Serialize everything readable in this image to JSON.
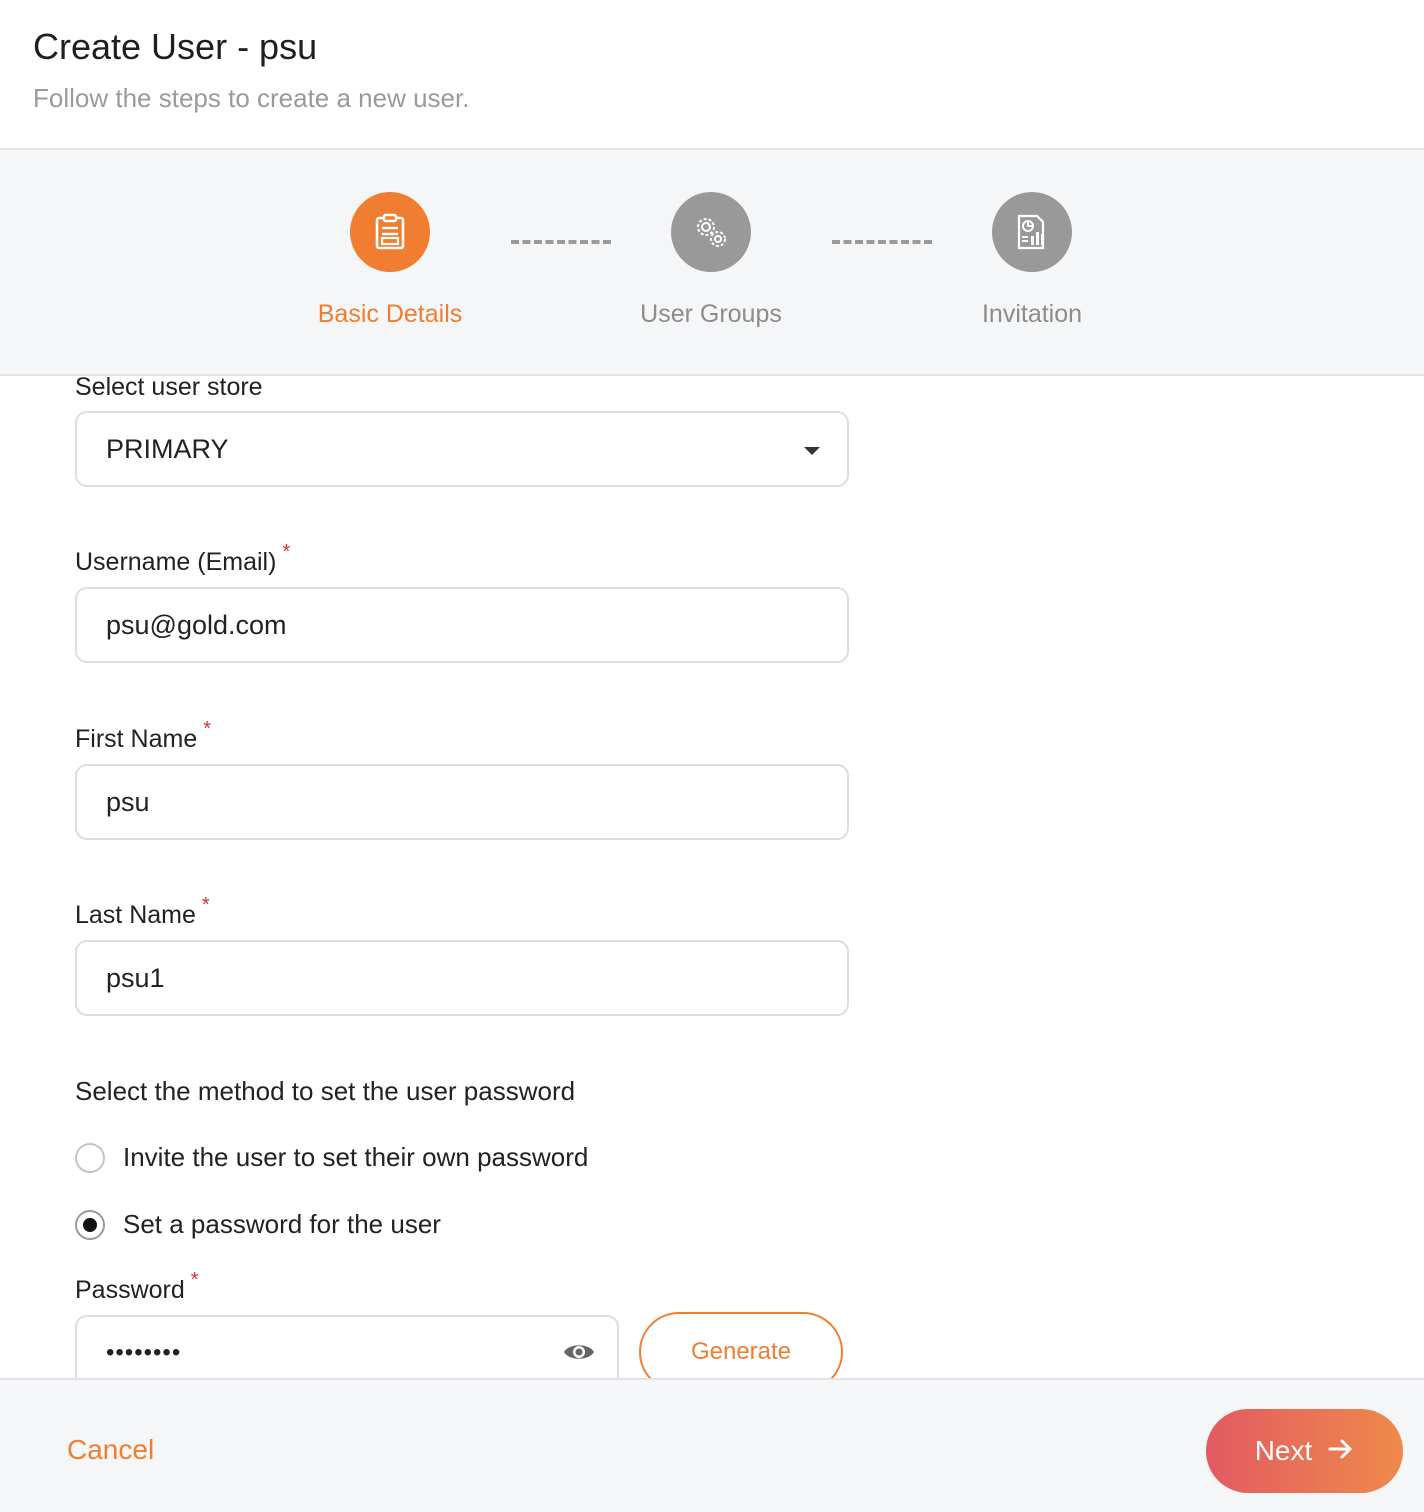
{
  "header": {
    "title": "Create User - psu",
    "subtitle": "Follow the steps to create a new user."
  },
  "steps": [
    {
      "label": "Basic Details",
      "icon": "clipboard-icon",
      "state": "active"
    },
    {
      "label": "User Groups",
      "icon": "gears-icon",
      "state": "inactive"
    },
    {
      "label": "Invitation",
      "icon": "report-icon",
      "state": "inactive"
    }
  ],
  "form": {
    "user_store": {
      "label": "Select user store",
      "value": "PRIMARY"
    },
    "username": {
      "label": "Username (Email)",
      "value": "psu@gold.com",
      "required": "*"
    },
    "first_name": {
      "label": "First Name",
      "value": "psu",
      "required": "*"
    },
    "last_name": {
      "label": "Last Name",
      "value": "psu1",
      "required": "*"
    },
    "password_method": {
      "label": "Select the method to set the user password",
      "options": [
        {
          "label": "Invite the user to set their own password",
          "checked": false
        },
        {
          "label": "Set a password for the user",
          "checked": true
        }
      ]
    },
    "password": {
      "label": "Password",
      "value": "••••••••",
      "required": "*",
      "generate_label": "Generate"
    }
  },
  "footer": {
    "cancel_label": "Cancel",
    "next_label": "Next"
  },
  "colors": {
    "accent": "#f07d30",
    "inactive": "#999999",
    "required": "#d93030"
  }
}
